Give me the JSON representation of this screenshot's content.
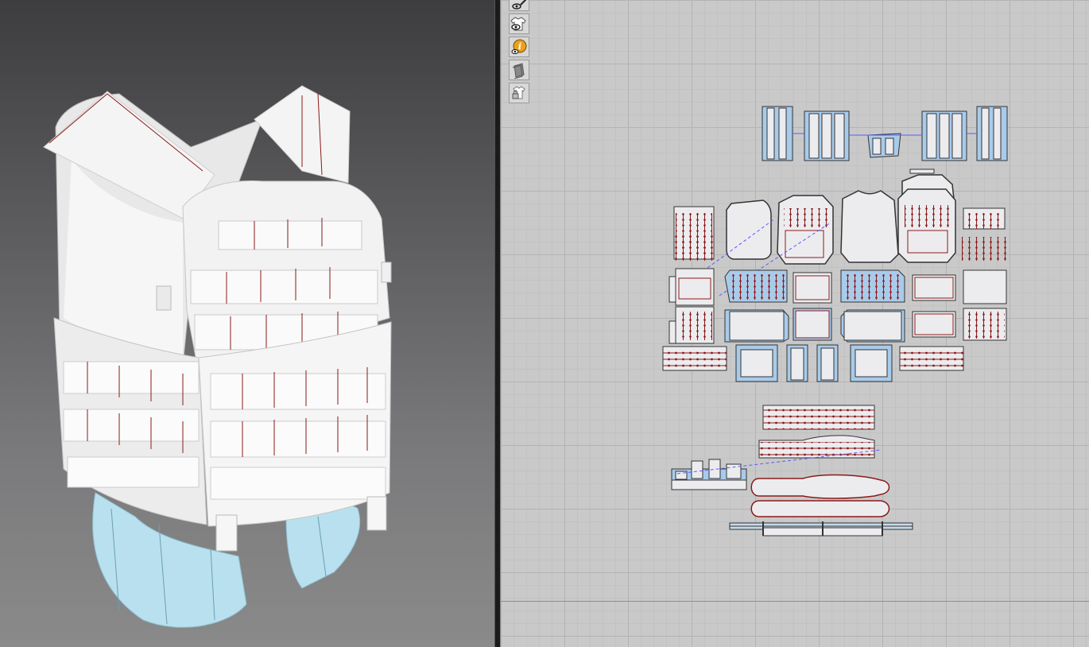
{
  "app": {
    "viewports": [
      "3d-garment-view",
      "2d-pattern-view"
    ]
  },
  "toolbar_2d": {
    "tools": [
      {
        "icon": "pencil-eye-icon"
      },
      {
        "icon": "show-garment-icon"
      },
      {
        "icon": "info-icon"
      },
      {
        "icon": "layer-icon"
      },
      {
        "icon": "lock-garment-icon"
      }
    ]
  },
  "colors": {
    "viewport_top": "#3d3d40",
    "viewport_bottom": "#8a8a8a",
    "grid_bg": "#c9c9c9",
    "pattern_fill": "#ececef",
    "pattern_selected": "#a9cbea",
    "seam_red": "#8b1a1a",
    "outline_black": "#333333",
    "link_blue": "#5a5aff",
    "belt_blue": "#b9e0ee"
  }
}
